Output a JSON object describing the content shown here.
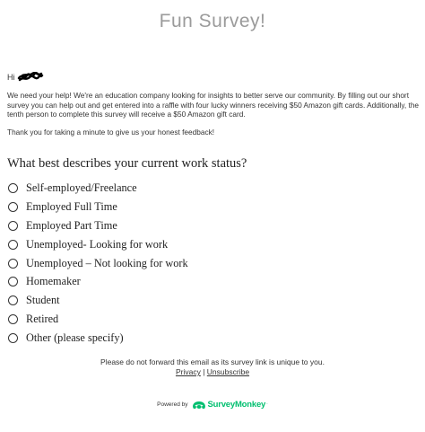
{
  "header": {
    "title": "Fun Survey!"
  },
  "email": {
    "greeting": "Hi",
    "intro": "We need your help! We're an education company looking for insights to better serve our community. By filling out our short survey you can help out and get entered into a raffle with four lucky winners receiving $50 Amazon gift cards. Additionally, the tenth person to complete this survey will receive a $50 Amazon gift card.",
    "thanks": "Thank you for taking a minute to give us your honest feedback!"
  },
  "question": {
    "text": "What best describes your current work status?",
    "options": [
      "Self-employed/Freelance",
      "Employed Full Time",
      "Employed Part Time",
      "Unemployed- Looking for work",
      "Unemployed – Not looking for work",
      "Homemaker",
      "Student",
      "Retired",
      "Other (please specify)"
    ]
  },
  "footer": {
    "note": "Please do not forward this email as its survey link is unique to you.",
    "privacy": "Privacy",
    "separator": "|",
    "unsubscribe": "Unsubscribe",
    "powered_by": "Powered by",
    "brand": "SurveyMonkey",
    "brand_mark": "·"
  },
  "colors": {
    "title": "#9b9b9b",
    "text": "#333333",
    "brand_green": "#00bf6f",
    "redaction": "#000000"
  },
  "icons": {
    "radio": "radio-button-icon",
    "logo": "surveymonkey-logo-icon",
    "redaction": "redaction-scribble"
  }
}
